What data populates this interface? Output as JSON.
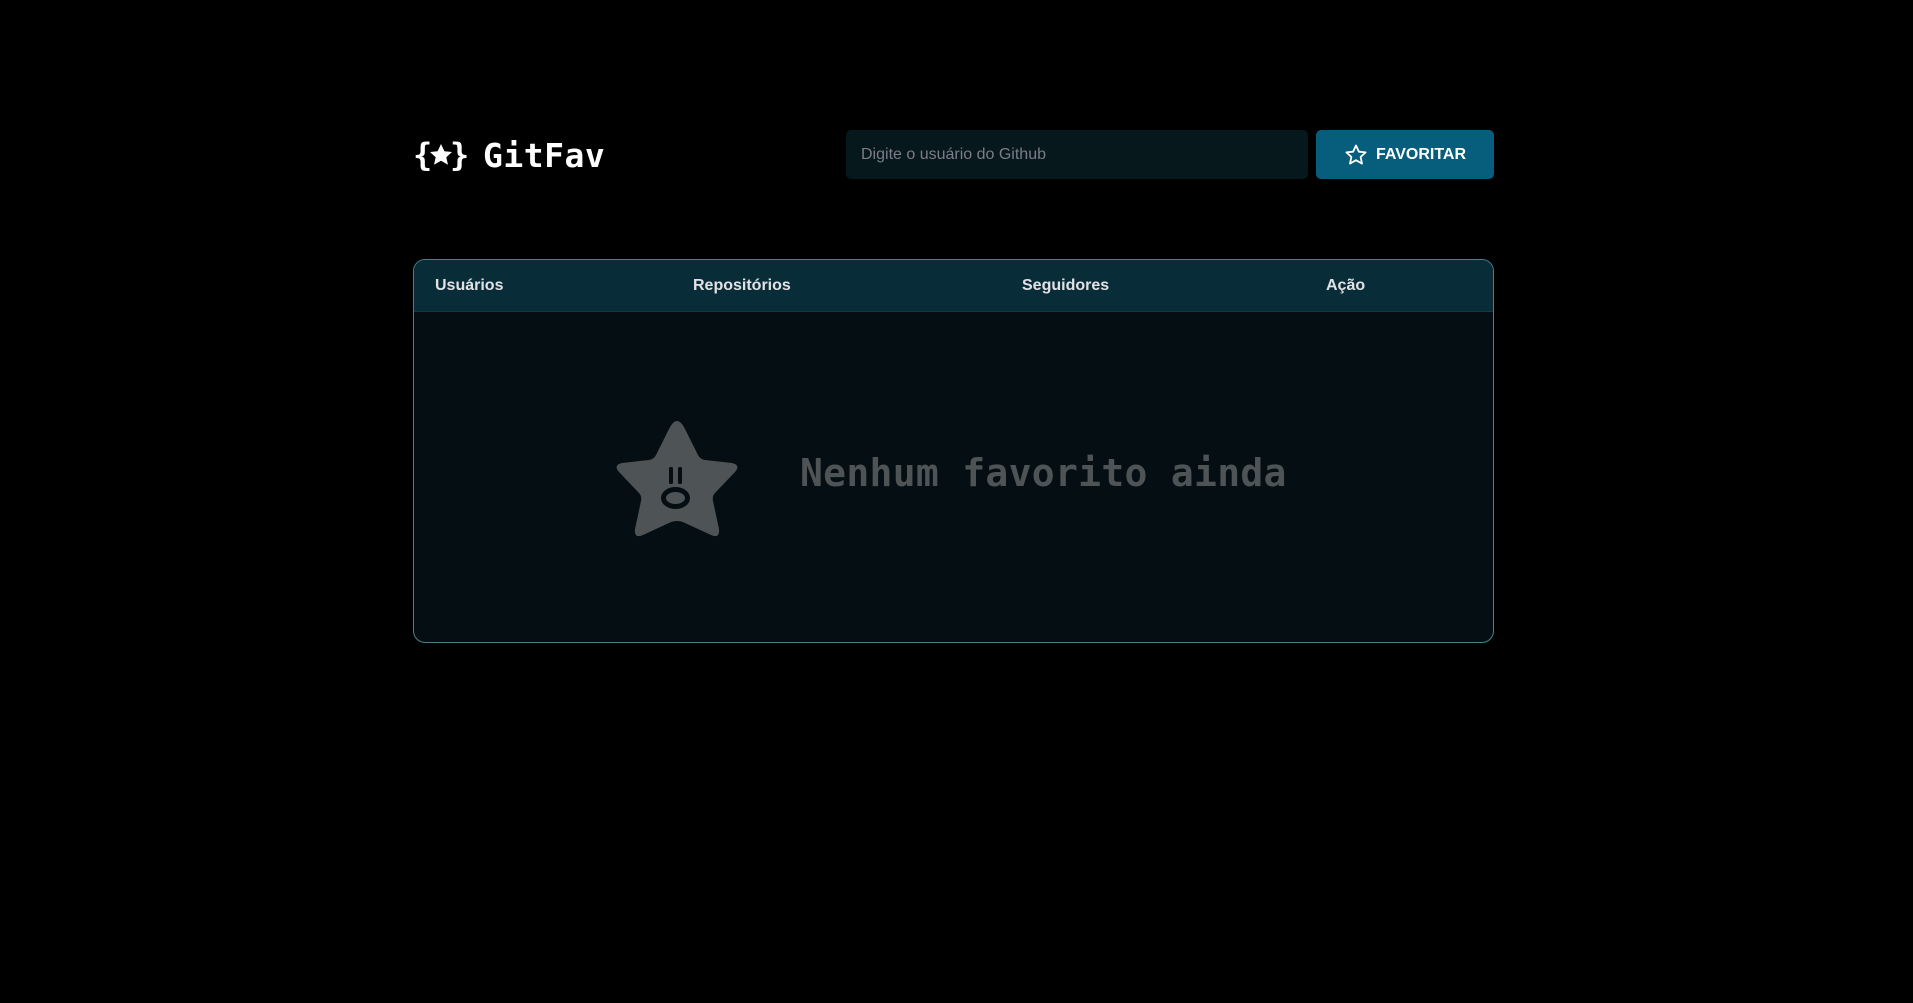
{
  "header": {
    "app_name": "GitFav",
    "logo_icon": "braces-star-icon"
  },
  "search": {
    "placeholder": "Digite o usuário do Github",
    "value": ""
  },
  "favorite_button": {
    "label": "FAVORITAR",
    "icon": "star-outline-icon"
  },
  "table": {
    "columns": [
      "Usuários",
      "Repositórios",
      "Seguidores",
      "Ação"
    ],
    "rows": []
  },
  "empty_state": {
    "icon": "sad-star-icon",
    "message": "Nenhum favorito ainda"
  },
  "colors": {
    "background": "#000000",
    "accent": "#065e7c",
    "table_header": "#092d38",
    "table_border": "#4a808c",
    "empty_text": "#4e5455"
  }
}
